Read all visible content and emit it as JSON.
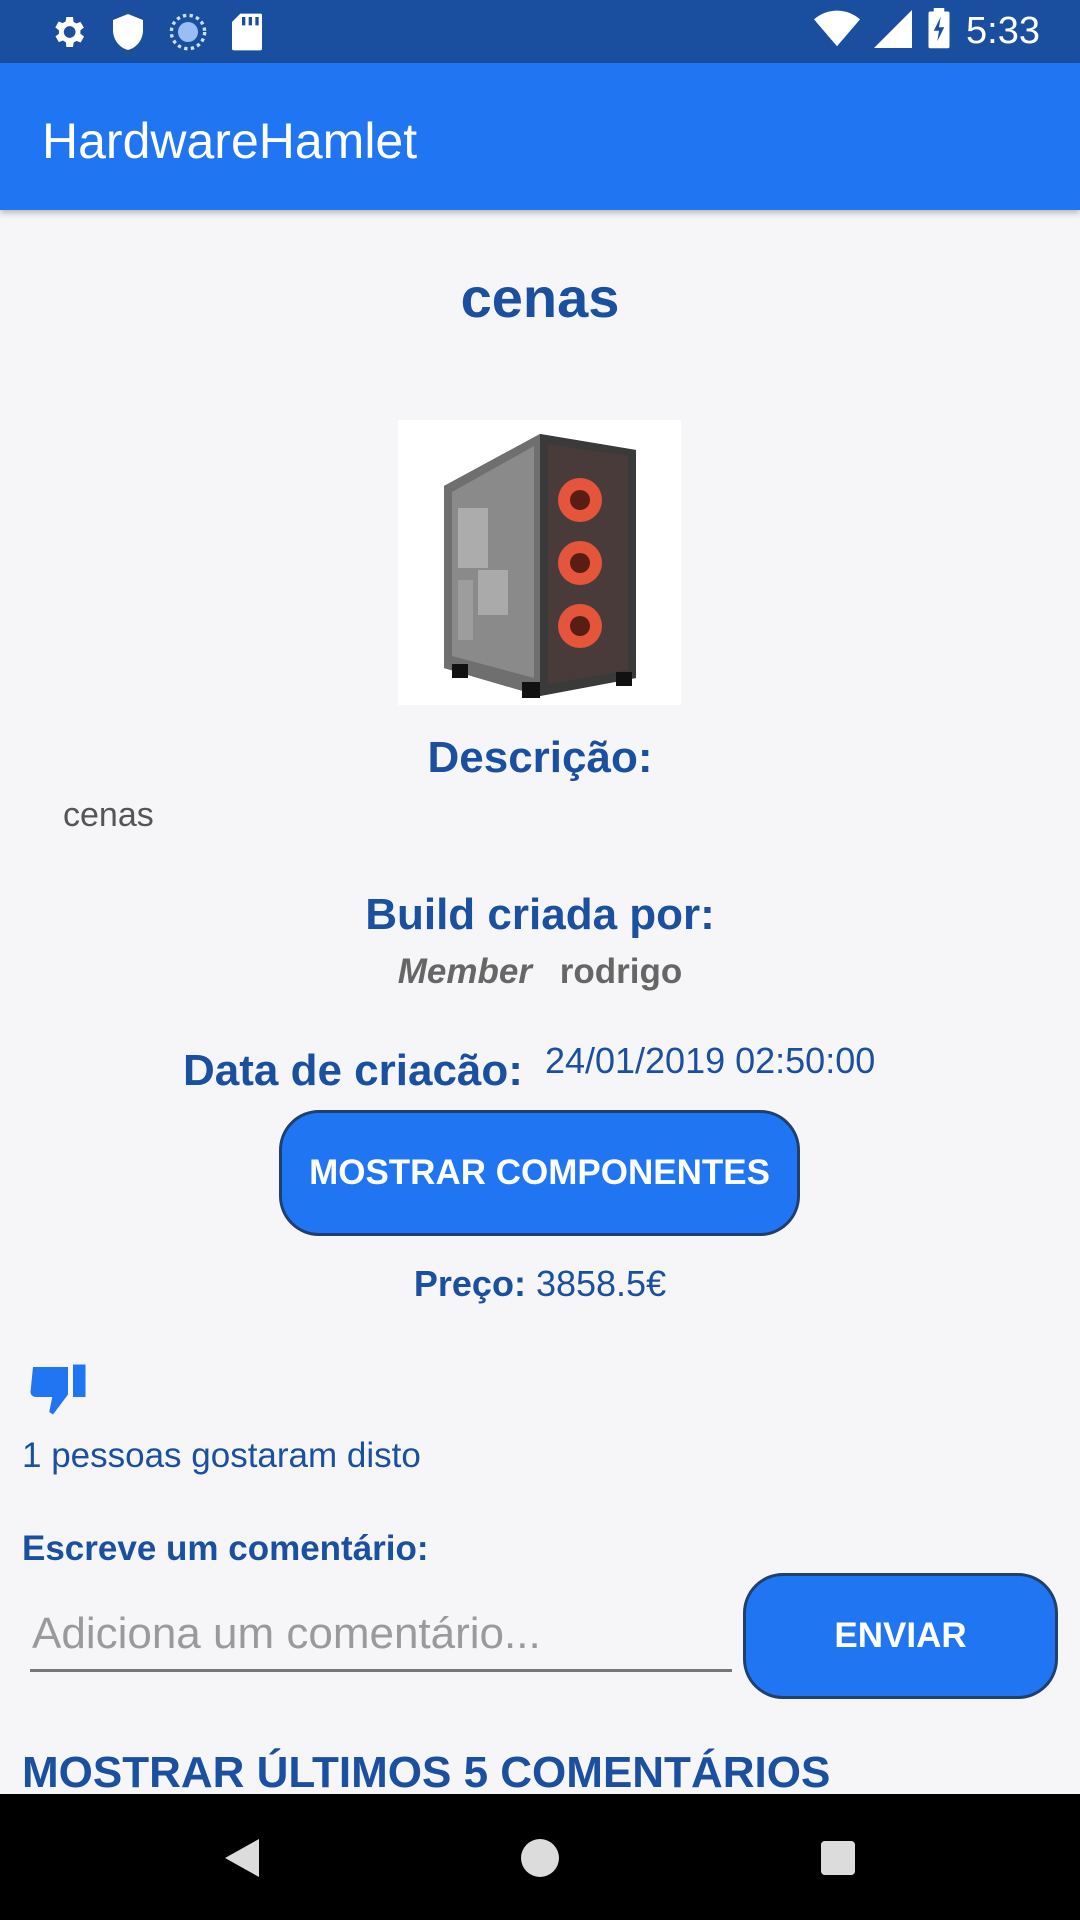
{
  "status_bar": {
    "time": "5:33",
    "icons": [
      "settings-icon",
      "shield-icon",
      "sync-icon",
      "sd-card-icon",
      "wifi-icon",
      "signal-icon",
      "battery-charging-icon"
    ]
  },
  "app_bar": {
    "title": "HardwareHamlet"
  },
  "build": {
    "name": "cenas",
    "image_icon": "pc-case-image"
  },
  "description": {
    "label": "Descrição:",
    "text": "cenas"
  },
  "author": {
    "label": "Build criada por:",
    "role": "Member",
    "username": "rodrigo"
  },
  "creation": {
    "label": "Data de criacão:",
    "date": "24/01/2019 02:50:00"
  },
  "buttons": {
    "show_components": "MOSTRAR COMPONENTES",
    "send": "ENVIAR"
  },
  "price": {
    "label": "Preço:",
    "value": "3858.5€"
  },
  "likes": {
    "icon": "thumbs-down-icon",
    "text": "1 pessoas gostaram disto"
  },
  "comment": {
    "label": "Escreve um comentário:",
    "placeholder": "Adiciona um comentário...",
    "value": ""
  },
  "last_comments_link": "MOSTRAR ÚLTIMOS 5 COMENTÁRIOS",
  "nav_bar": {
    "icons": [
      "back-icon",
      "home-icon",
      "recents-icon"
    ]
  },
  "colors": {
    "status_bar": "#1a4f9f",
    "app_bar": "#2075f3",
    "accent_text": "#1b4f9f",
    "background": "#f6f6f8"
  }
}
